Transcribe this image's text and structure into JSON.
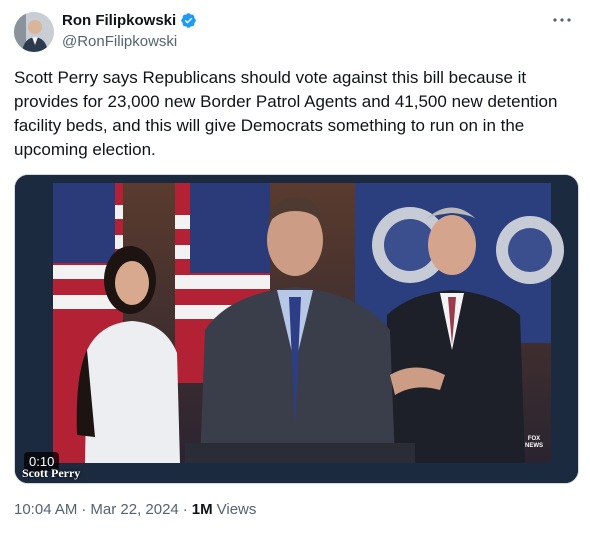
{
  "author": {
    "display_name": "Ron Filipkowski",
    "handle": "@RonFilipkowski",
    "verified": true,
    "verified_color": "#1d9bf0"
  },
  "tweet": {
    "text": "Scott Perry says Republicans should vote against this bill because it provides for 23,000 new Border Patrol Agents and 41,500 new detention facility beds, and this will give Democrats something to run on in the upcoming election."
  },
  "video": {
    "duration": "0:10",
    "chyron": "Scott Perry",
    "network_logo": "FOX NEWS"
  },
  "meta": {
    "time": "10:04 AM",
    "separator_1": "·",
    "date": "Mar 22, 2024",
    "separator_2": "·",
    "views_count": "1M",
    "views_label": "Views"
  },
  "icons": {
    "more": "more-options-icon",
    "verified": "verified-badge-icon"
  }
}
